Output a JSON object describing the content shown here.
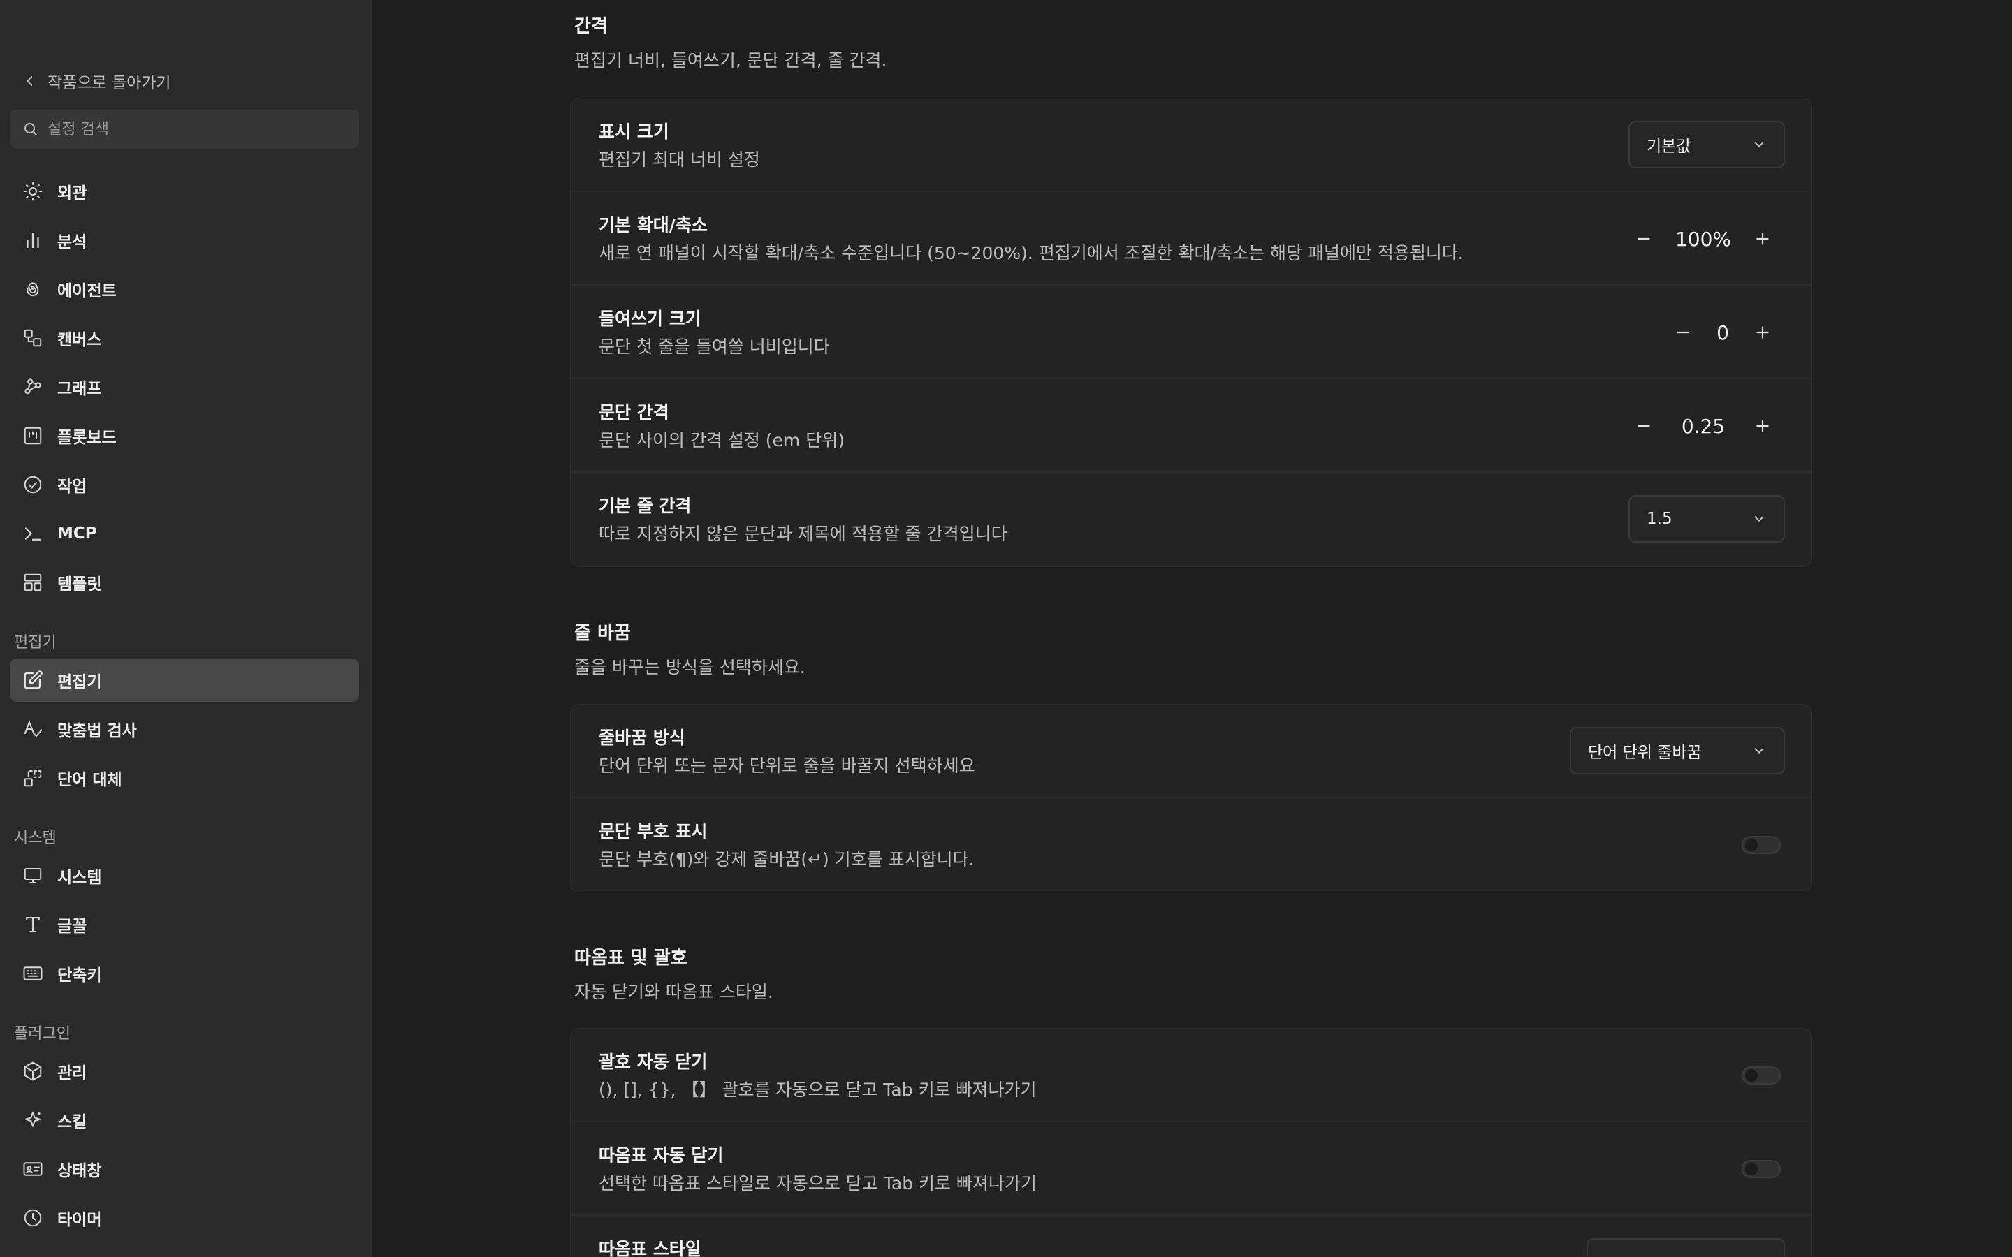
{
  "sidebar": {
    "back_label": "작품으로 돌아가기",
    "search_placeholder": "설정 검색",
    "items": [
      {
        "label": "외관",
        "icon": "sun-icon"
      },
      {
        "label": "분석",
        "icon": "bar-chart-icon"
      },
      {
        "label": "에이전트",
        "icon": "spiral-icon"
      },
      {
        "label": "캔버스",
        "icon": "canvas-icon"
      },
      {
        "label": "그래프",
        "icon": "graph-icon"
      },
      {
        "label": "플롯보드",
        "icon": "kanban-icon"
      },
      {
        "label": "작업",
        "icon": "check-circle-icon"
      },
      {
        "label": "MCP",
        "icon": "terminal-icon"
      },
      {
        "label": "템플릿",
        "icon": "template-icon"
      }
    ],
    "section_editor": "편집기",
    "editor_items": [
      {
        "label": "편집기",
        "icon": "edit-icon"
      },
      {
        "label": "맞춤법 검사",
        "icon": "spellcheck-icon"
      },
      {
        "label": "단어 대체",
        "icon": "replace-icon"
      }
    ],
    "section_system": "시스템",
    "system_items": [
      {
        "label": "시스템",
        "icon": "monitor-icon"
      },
      {
        "label": "글꼴",
        "icon": "type-icon"
      },
      {
        "label": "단축키",
        "icon": "keyboard-icon"
      }
    ],
    "section_plugin": "플러그인",
    "plugin_items": [
      {
        "label": "관리",
        "icon": "package-icon"
      },
      {
        "label": "스킬",
        "icon": "sparkles-icon"
      },
      {
        "label": "상태창",
        "icon": "id-card-icon"
      },
      {
        "label": "타이머",
        "icon": "clock-icon"
      }
    ]
  },
  "spacing": {
    "title": "간격",
    "desc": "편집기 너비, 들여쓰기, 문단 간격, 줄 간격.",
    "display_size": {
      "title": "표시 크기",
      "desc": "편집기 최대 너비 설정",
      "value": "기본값"
    },
    "zoom": {
      "title": "기본 확대/축소",
      "desc": "새로 연 패널이 시작할 확대/축소 수준입니다 (50~200%). 편집기에서 조절한 확대/축소는 해당 패널에만 적용됩니다.",
      "value": "100%"
    },
    "indent": {
      "title": "들여쓰기 크기",
      "desc": "문단 첫 줄을 들여쓸 너비입니다",
      "value": "0"
    },
    "paragraph": {
      "title": "문단 간격",
      "desc": "문단 사이의 간격 설정 (em 단위)",
      "value": "0.25"
    },
    "line_height": {
      "title": "기본 줄 간격",
      "desc": "따로 지정하지 않은 문단과 제목에 적용할 줄 간격입니다",
      "value": "1.5"
    }
  },
  "wrap": {
    "title": "줄 바꿈",
    "desc": "줄을 바꾸는 방식을 선택하세요.",
    "mode": {
      "title": "줄바꿈 방식",
      "desc": "단어 단위 또는 문자 단위로 줄을 바꿀지 선택하세요",
      "value": "단어 단위 줄바꿈"
    },
    "marks": {
      "title": "문단 부호 표시",
      "desc": "문단 부호(¶)와 강제 줄바꿈(↵) 기호를 표시합니다.",
      "enabled": false
    }
  },
  "quotes": {
    "title": "따옴표 및 괄호",
    "desc": "자동 닫기와 따옴표 스타일.",
    "brackets": {
      "title": "괄호 자동 닫기",
      "desc": "(), [], {}, 【】 괄호를 자동으로 닫고 Tab 키로 빠져나가기",
      "enabled": false
    },
    "quote_close": {
      "title": "따옴표 자동 닫기",
      "desc": "선택한 따옴표 스타일로 자동으로 닫고 Tab 키로 빠져나가기",
      "enabled": false
    },
    "style": {
      "title": "따옴표 스타일"
    }
  }
}
